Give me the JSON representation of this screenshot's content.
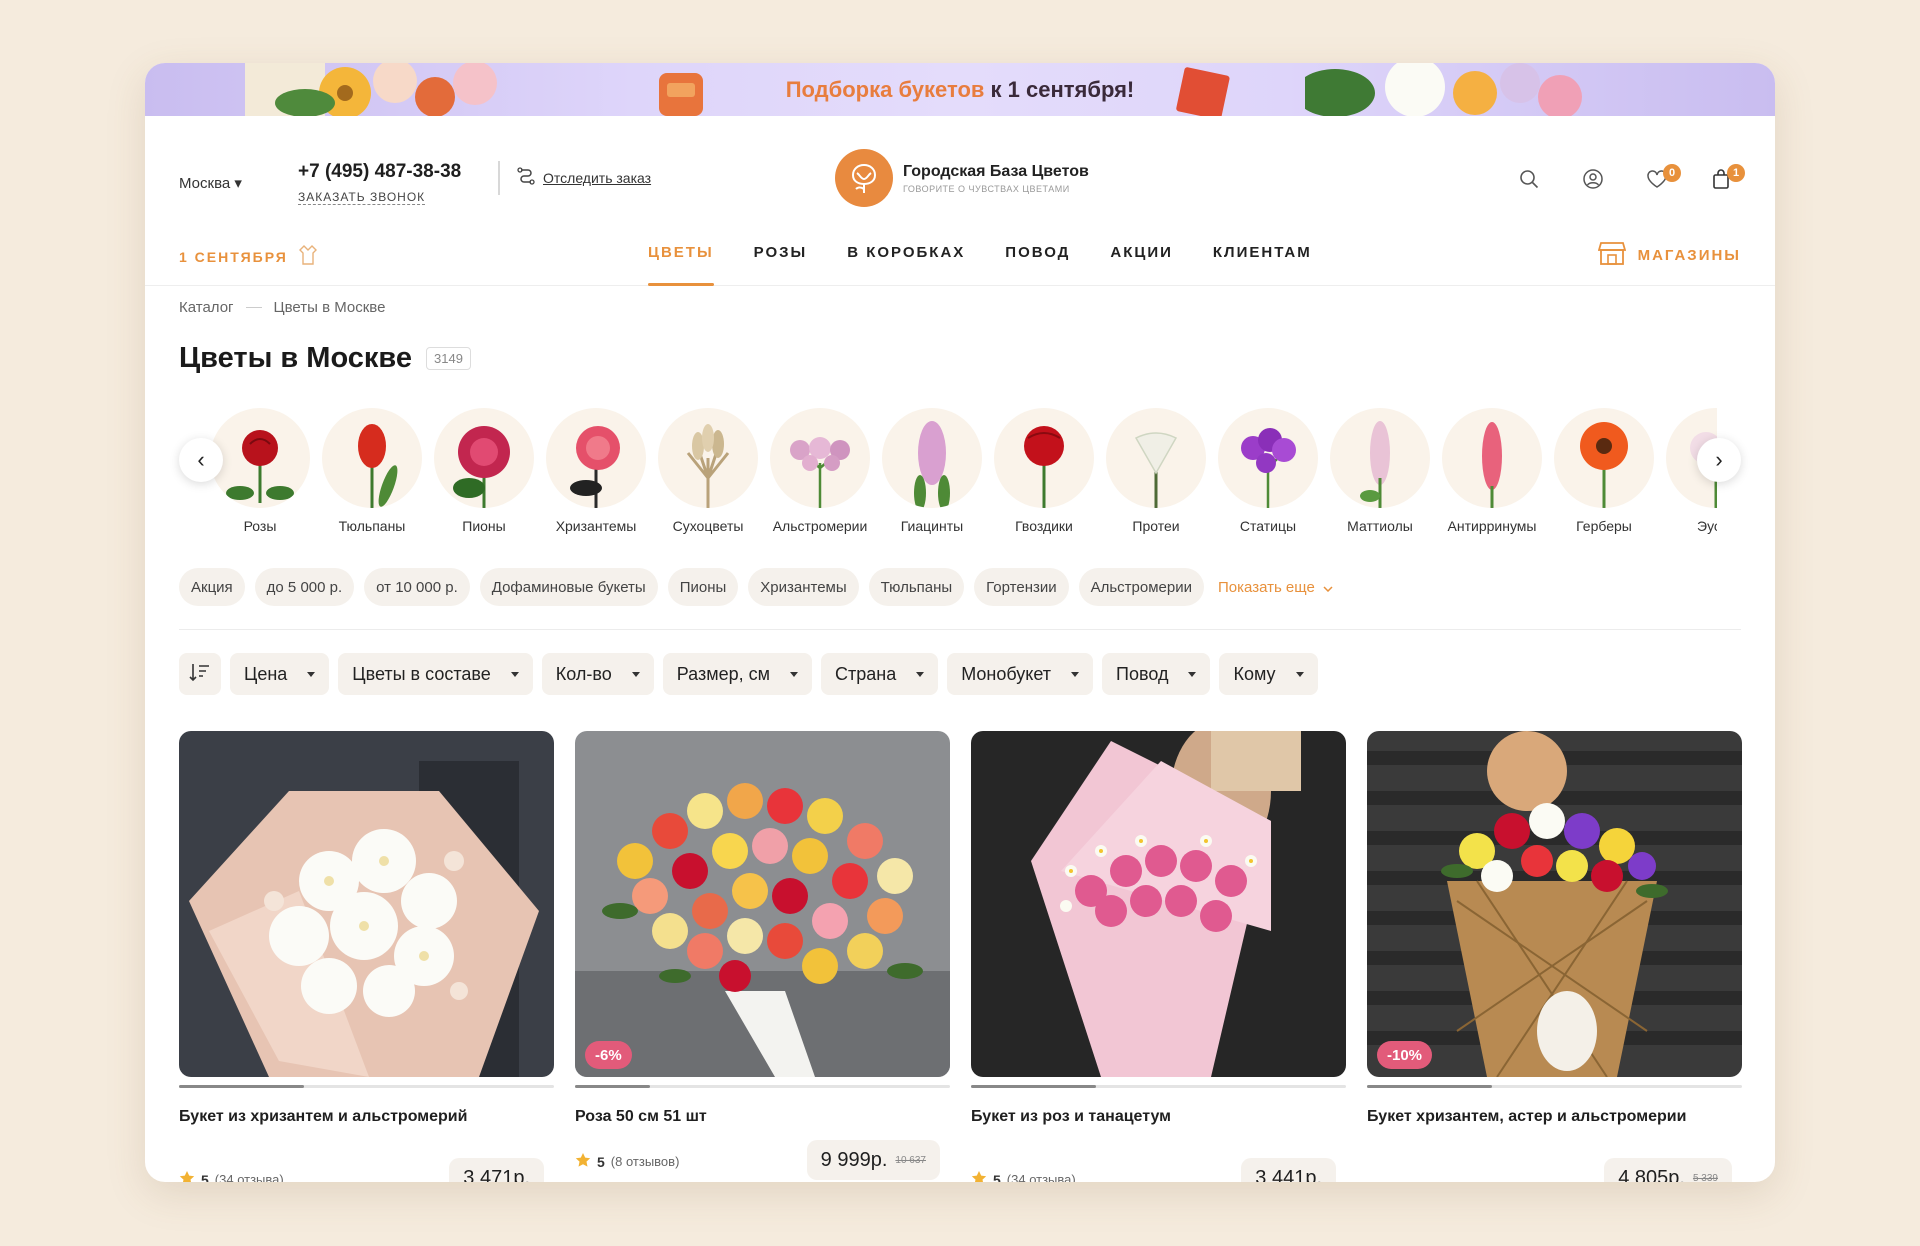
{
  "banner": {
    "text_highlight": "Подборка букетов",
    "text_rest": " к 1 сентября!"
  },
  "header": {
    "city": "Москва",
    "phone": "+7 (495) 487-38-38",
    "callback": "ЗАКАЗАТЬ ЗВОНОК",
    "track_order": "Отследить заказ",
    "logo_name": "Городская База Цветов",
    "logo_slogan": "ГОВОРИТЕ О ЧУВСТВАХ ЦВЕТАМИ",
    "favorites_count": "0",
    "cart_count": "1"
  },
  "nav": {
    "promo": "1 СЕНТЯБРЯ",
    "items": [
      "ЦВЕТЫ",
      "РОЗЫ",
      "В КОРОБКАХ",
      "ПОВОД",
      "АКЦИИ",
      "КЛИЕНТАМ"
    ],
    "stores": "МАГАЗИНЫ"
  },
  "breadcrumb": {
    "catalog": "Каталог",
    "current": "Цветы в Москве"
  },
  "page": {
    "title": "Цветы в Москве",
    "count": "3149"
  },
  "categories": [
    "Розы",
    "Тюльпаны",
    "Пионы",
    "Хризантемы",
    "Сухоцветы",
    "Альстромерии",
    "Гиацинты",
    "Гвоздики",
    "Протеи",
    "Статицы",
    "Маттиолы",
    "Антирринумы",
    "Герберы",
    "Эусто"
  ],
  "chips": [
    "Акция",
    "до 5 000 р.",
    "от 10 000 р.",
    "Дофаминовые букеты",
    "Пионы",
    "Хризантемы",
    "Тюльпаны",
    "Гортензии",
    "Альстромерии"
  ],
  "chips_more": "Показать еще",
  "filters": [
    "Цена",
    "Цветы в составе",
    "Кол-во",
    "Размер, см",
    "Страна",
    "Монобукет",
    "Повод",
    "Кому"
  ],
  "products": [
    {
      "name": "Букет из хризантем и альстромерий",
      "rating": "5",
      "reviews": "(34 отзыва)",
      "price": "3 471р.",
      "old_price": "",
      "discount": ""
    },
    {
      "name": "Роза 50 см 51 шт",
      "rating": "5",
      "reviews": "(8 отзывов)",
      "price": "9 999р.",
      "old_price": "10 637",
      "discount": "-6%"
    },
    {
      "name": "Букет из роз и танацетум",
      "rating": "5",
      "reviews": "(34 отзыва)",
      "price": "3 441р.",
      "old_price": "",
      "discount": ""
    },
    {
      "name": "Букет хризантем, астер и альстромерии",
      "rating": "",
      "reviews": "",
      "price": "4 805р.",
      "old_price": "5 339",
      "discount": "-10%"
    }
  ],
  "colors": {
    "accent": "#e8913c",
    "discount": "#e25b7a",
    "chip_bg": "#f5f1ec",
    "page_bg": "#f5ebdd"
  }
}
